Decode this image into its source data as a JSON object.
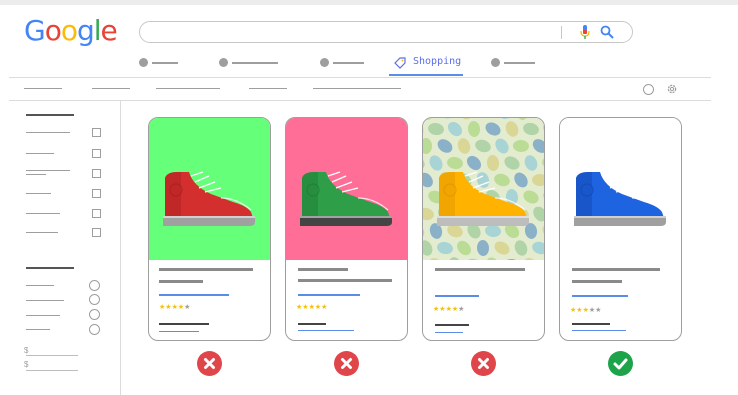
{
  "logo": {
    "letters": [
      {
        "char": "G",
        "color": "#4285f4"
      },
      {
        "char": "o",
        "color": "#ea4335"
      },
      {
        "char": "o",
        "color": "#fbbc05"
      },
      {
        "char": "g",
        "color": "#4285f4"
      },
      {
        "char": "l",
        "color": "#34a853"
      },
      {
        "char": "e",
        "color": "#ea4335"
      }
    ]
  },
  "search": {
    "placeholder": "",
    "icons": [
      "microphone-icon",
      "search-icon"
    ]
  },
  "tabs": {
    "active_label": "Shopping",
    "active_icon": "price-tag-icon",
    "accent": "#5b8de8"
  },
  "toolbar": {
    "icons": [
      "help-icon",
      "gear-icon"
    ]
  },
  "filters": {
    "price_prefix": "$"
  },
  "products": [
    {
      "background": "#66ff7a",
      "shoe_color": "#d32f2f",
      "shoe_dark": "#a82020",
      "sole": "#a0a0a0",
      "rating": 4,
      "verdict": "rejected",
      "pattern": false
    },
    {
      "background": "#ff6e96",
      "shoe_color": "#2e9e48",
      "shoe_dark": "#1f7a35",
      "sole": "#444444",
      "rating": 5,
      "verdict": "rejected",
      "pattern": false
    },
    {
      "background": "#e4ecd0",
      "shoe_color": "#ffb300",
      "shoe_dark": "#e09400",
      "sole": "#bdbdbd",
      "rating": 4,
      "verdict": "rejected",
      "pattern": true
    },
    {
      "background": "#ffffff",
      "shoe_color": "#1e63e0",
      "shoe_dark": "#1548b0",
      "sole": "#a0a0a0",
      "rating": 3,
      "verdict": "approved",
      "pattern": false
    }
  ],
  "colors": {
    "rejected": "#e0454a",
    "approved": "#1fa34a",
    "star_on": "#f4c20d",
    "star_off": "#9e9e9e"
  }
}
